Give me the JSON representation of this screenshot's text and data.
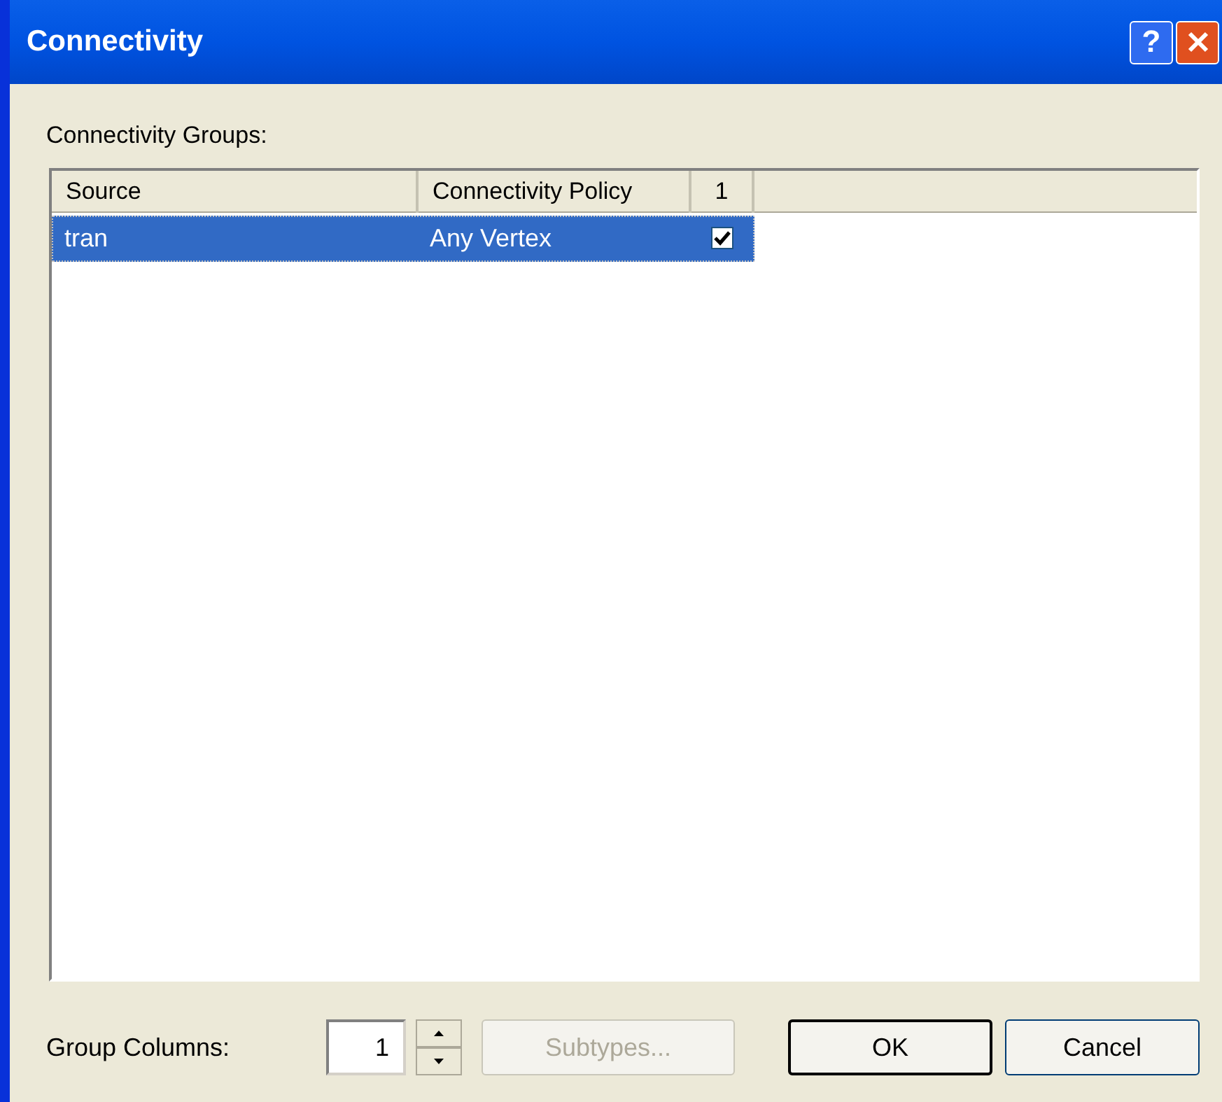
{
  "window": {
    "title": "Connectivity",
    "help_button": "?"
  },
  "groups_label": "Connectivity Groups:",
  "table": {
    "columns": [
      "Source",
      "Connectivity Policy",
      "1"
    ],
    "rows": [
      {
        "cells": [
          "tran",
          "Any Vertex"
        ],
        "checked": true,
        "selected": true
      }
    ]
  },
  "group_columns": {
    "label": "Group Columns:",
    "value": "1"
  },
  "buttons": [
    {
      "label": "Subtypes...",
      "disabled": true,
      "default": false
    },
    {
      "label": "OK",
      "disabled": false,
      "default": true
    },
    {
      "label": "Cancel",
      "disabled": false,
      "default": false
    }
  ]
}
